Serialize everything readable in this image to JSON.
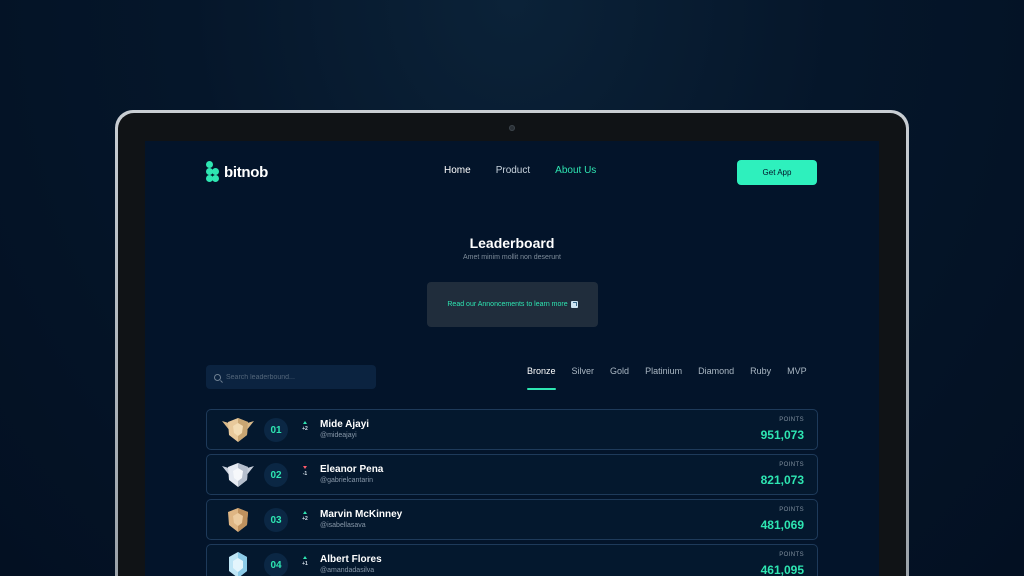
{
  "brand": {
    "name": "bitnob",
    "accent": "#2ee6b2"
  },
  "nav": {
    "links": [
      {
        "label": "Home",
        "state": "active"
      },
      {
        "label": "Product",
        "state": "normal"
      },
      {
        "label": "About Us",
        "state": "accent"
      }
    ],
    "cta_label": "Get App"
  },
  "hero": {
    "title": "Leaderboard",
    "subtitle": "Amet minim mollit non deserunt",
    "announcement": "Read our Annoncements to learn more"
  },
  "search": {
    "placeholder": "Search leaderbound..."
  },
  "tabs": {
    "items": [
      "Bronze",
      "Silver",
      "Gold",
      "Platinium",
      "Diamond",
      "Ruby",
      "MVP"
    ],
    "selected": "Bronze"
  },
  "leaderboard": {
    "points_label": "POINTS",
    "rows": [
      {
        "rank": "01",
        "change": "+2",
        "direction": "up",
        "name": "Mide Ajayi",
        "handle": "@mideajayi",
        "points": "951,073",
        "badge": "gold-winged-shield-icon"
      },
      {
        "rank": "02",
        "change": "-1",
        "direction": "down",
        "name": "Eleanor Pena",
        "handle": "@gabrielcantarin",
        "points": "821,073",
        "badge": "silver-winged-shield-icon"
      },
      {
        "rank": "03",
        "change": "+2",
        "direction": "up",
        "name": "Marvin McKinney",
        "handle": "@isabellasava",
        "points": "481,069",
        "badge": "bronze-shield-icon"
      },
      {
        "rank": "04",
        "change": "+1",
        "direction": "up",
        "name": "Albert Flores",
        "handle": "@amandadasilva",
        "points": "461,095",
        "badge": "diamond-shield-icon"
      }
    ]
  }
}
